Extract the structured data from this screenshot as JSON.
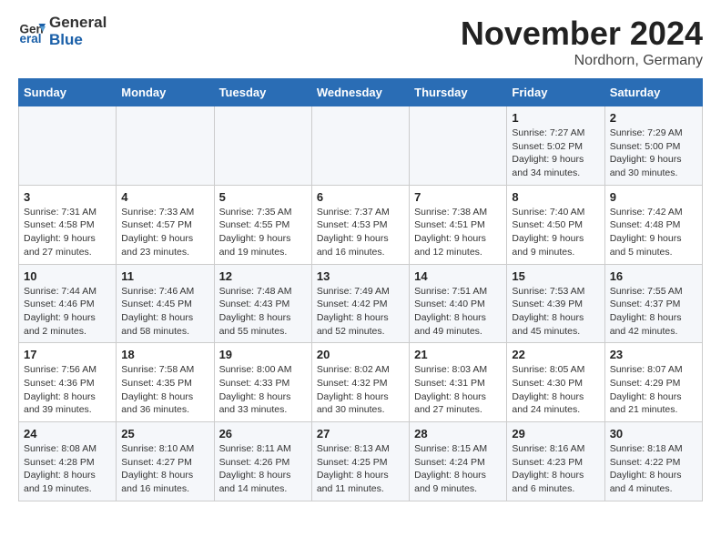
{
  "header": {
    "logo_line1": "General",
    "logo_line2": "Blue",
    "month": "November 2024",
    "location": "Nordhorn, Germany"
  },
  "columns": [
    "Sunday",
    "Monday",
    "Tuesday",
    "Wednesday",
    "Thursday",
    "Friday",
    "Saturday"
  ],
  "weeks": [
    [
      {
        "day": "",
        "info": ""
      },
      {
        "day": "",
        "info": ""
      },
      {
        "day": "",
        "info": ""
      },
      {
        "day": "",
        "info": ""
      },
      {
        "day": "",
        "info": ""
      },
      {
        "day": "1",
        "info": "Sunrise: 7:27 AM\nSunset: 5:02 PM\nDaylight: 9 hours and 34 minutes."
      },
      {
        "day": "2",
        "info": "Sunrise: 7:29 AM\nSunset: 5:00 PM\nDaylight: 9 hours and 30 minutes."
      }
    ],
    [
      {
        "day": "3",
        "info": "Sunrise: 7:31 AM\nSunset: 4:58 PM\nDaylight: 9 hours and 27 minutes."
      },
      {
        "day": "4",
        "info": "Sunrise: 7:33 AM\nSunset: 4:57 PM\nDaylight: 9 hours and 23 minutes."
      },
      {
        "day": "5",
        "info": "Sunrise: 7:35 AM\nSunset: 4:55 PM\nDaylight: 9 hours and 19 minutes."
      },
      {
        "day": "6",
        "info": "Sunrise: 7:37 AM\nSunset: 4:53 PM\nDaylight: 9 hours and 16 minutes."
      },
      {
        "day": "7",
        "info": "Sunrise: 7:38 AM\nSunset: 4:51 PM\nDaylight: 9 hours and 12 minutes."
      },
      {
        "day": "8",
        "info": "Sunrise: 7:40 AM\nSunset: 4:50 PM\nDaylight: 9 hours and 9 minutes."
      },
      {
        "day": "9",
        "info": "Sunrise: 7:42 AM\nSunset: 4:48 PM\nDaylight: 9 hours and 5 minutes."
      }
    ],
    [
      {
        "day": "10",
        "info": "Sunrise: 7:44 AM\nSunset: 4:46 PM\nDaylight: 9 hours and 2 minutes."
      },
      {
        "day": "11",
        "info": "Sunrise: 7:46 AM\nSunset: 4:45 PM\nDaylight: 8 hours and 58 minutes."
      },
      {
        "day": "12",
        "info": "Sunrise: 7:48 AM\nSunset: 4:43 PM\nDaylight: 8 hours and 55 minutes."
      },
      {
        "day": "13",
        "info": "Sunrise: 7:49 AM\nSunset: 4:42 PM\nDaylight: 8 hours and 52 minutes."
      },
      {
        "day": "14",
        "info": "Sunrise: 7:51 AM\nSunset: 4:40 PM\nDaylight: 8 hours and 49 minutes."
      },
      {
        "day": "15",
        "info": "Sunrise: 7:53 AM\nSunset: 4:39 PM\nDaylight: 8 hours and 45 minutes."
      },
      {
        "day": "16",
        "info": "Sunrise: 7:55 AM\nSunset: 4:37 PM\nDaylight: 8 hours and 42 minutes."
      }
    ],
    [
      {
        "day": "17",
        "info": "Sunrise: 7:56 AM\nSunset: 4:36 PM\nDaylight: 8 hours and 39 minutes."
      },
      {
        "day": "18",
        "info": "Sunrise: 7:58 AM\nSunset: 4:35 PM\nDaylight: 8 hours and 36 minutes."
      },
      {
        "day": "19",
        "info": "Sunrise: 8:00 AM\nSunset: 4:33 PM\nDaylight: 8 hours and 33 minutes."
      },
      {
        "day": "20",
        "info": "Sunrise: 8:02 AM\nSunset: 4:32 PM\nDaylight: 8 hours and 30 minutes."
      },
      {
        "day": "21",
        "info": "Sunrise: 8:03 AM\nSunset: 4:31 PM\nDaylight: 8 hours and 27 minutes."
      },
      {
        "day": "22",
        "info": "Sunrise: 8:05 AM\nSunset: 4:30 PM\nDaylight: 8 hours and 24 minutes."
      },
      {
        "day": "23",
        "info": "Sunrise: 8:07 AM\nSunset: 4:29 PM\nDaylight: 8 hours and 21 minutes."
      }
    ],
    [
      {
        "day": "24",
        "info": "Sunrise: 8:08 AM\nSunset: 4:28 PM\nDaylight: 8 hours and 19 minutes."
      },
      {
        "day": "25",
        "info": "Sunrise: 8:10 AM\nSunset: 4:27 PM\nDaylight: 8 hours and 16 minutes."
      },
      {
        "day": "26",
        "info": "Sunrise: 8:11 AM\nSunset: 4:26 PM\nDaylight: 8 hours and 14 minutes."
      },
      {
        "day": "27",
        "info": "Sunrise: 8:13 AM\nSunset: 4:25 PM\nDaylight: 8 hours and 11 minutes."
      },
      {
        "day": "28",
        "info": "Sunrise: 8:15 AM\nSunset: 4:24 PM\nDaylight: 8 hours and 9 minutes."
      },
      {
        "day": "29",
        "info": "Sunrise: 8:16 AM\nSunset: 4:23 PM\nDaylight: 8 hours and 6 minutes."
      },
      {
        "day": "30",
        "info": "Sunrise: 8:18 AM\nSunset: 4:22 PM\nDaylight: 8 hours and 4 minutes."
      }
    ]
  ]
}
